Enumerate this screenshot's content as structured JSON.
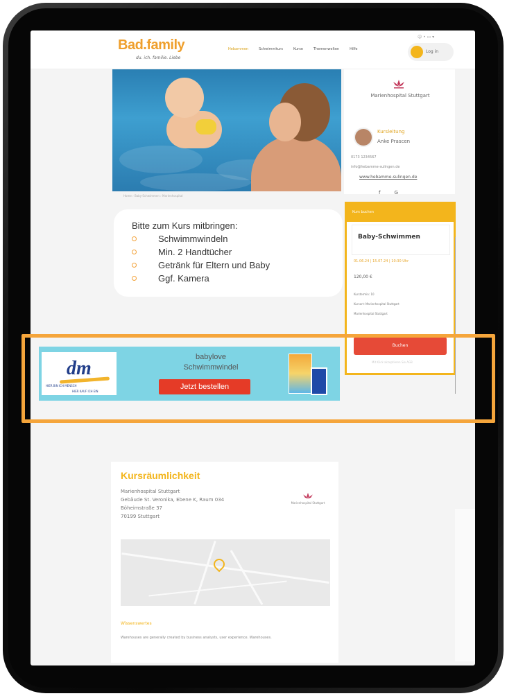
{
  "header": {
    "logo_main": "Bad.family",
    "logo_sub": "du. ich. familie. Liebe",
    "nav": [
      "Hebammen",
      "Schwimmkurs",
      "Kurse",
      "Themenwelten",
      "Hilfe"
    ],
    "login_label": "Log in",
    "top_icons": "☺ • ▭ ▾"
  },
  "breadcrumb": "Home › Baby-Schwimmen › Marienhospital",
  "sidebar": {
    "hospital_name": "Marienhospital Stuttgart",
    "role": "Kursleitung",
    "person": "Anke Prascen",
    "phone": "0173 1234567",
    "email": "info@hebamme-sulingen.de",
    "website": "www.hebamme-sulingen.de",
    "social": [
      "f",
      "G"
    ]
  },
  "booking": {
    "header": "Kurs buchen",
    "title": "Baby-Schwimmen",
    "dates": "01.06.24 | 15.07.24 | 10:30 Uhr",
    "price": "120,00 €",
    "meta": [
      "Kurstermin: 10",
      "Kursort: Marienhospital Stuttgart",
      "Marienhospital Stuttgart"
    ],
    "button": "Buchen",
    "footer": "Mit Klick akzeptieren Sie AGB"
  },
  "bring": {
    "title": "Bitte zum Kurs mitbringen:",
    "items": [
      "Schwimmwindeln",
      "Min. 2 Handtücher",
      "Getränk für Eltern und Baby",
      "Ggf. Kamera"
    ]
  },
  "ad": {
    "logo": "dm",
    "slogan1": "HIER BIN ICH MENSCH",
    "slogan2": "HIER KAUF ICH EIN",
    "brand": "babylove",
    "product": "Schwimmwindel",
    "cta": "Jetzt bestellen"
  },
  "location": {
    "heading": "Kursräumlichkeit",
    "address": [
      "Marienhospital Stuttgart",
      "Gebäude St. Veronika, Ebene K, Raum 034",
      "Böheimstraße 37",
      "70199 Stuttgart"
    ],
    "mini_logo": "Marienhospital Stuttgart",
    "subheading": "Wissenswertes",
    "description": "Warehouses are generally created by business analysts, user experience. Warehouses."
  },
  "colors": {
    "accent": "#f3b51c",
    "cta_red": "#e53b27",
    "ad_bg": "#7ed4e4",
    "highlight": "#f5a53b"
  }
}
